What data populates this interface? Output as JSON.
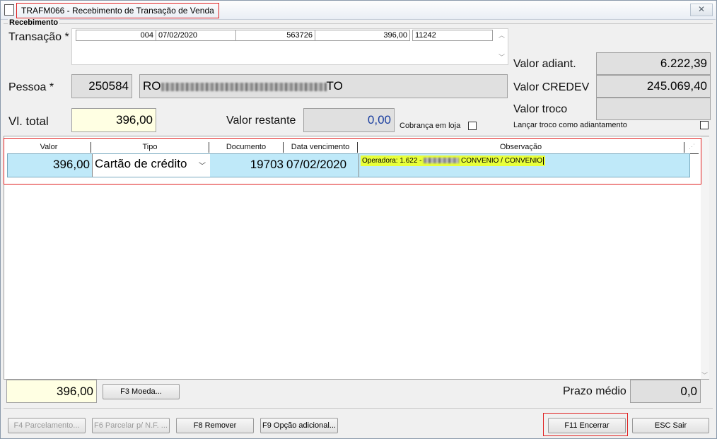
{
  "window": {
    "title": "TRAFM066 - Recebimento de Transação de Venda",
    "close_glyph": "✕"
  },
  "group": {
    "label": "Recebimento"
  },
  "transacao": {
    "label": "Transação *",
    "fields": [
      "004",
      "07/02/2020",
      "563726",
      "396,00",
      "11242"
    ]
  },
  "pessoa": {
    "label": "Pessoa *",
    "code": "250584",
    "name_start": "RO",
    "name_end": "TO"
  },
  "vl_total": {
    "label": "Vl. total",
    "value": "396,00"
  },
  "valor_restante": {
    "label": "Valor restante",
    "value": "0,00"
  },
  "cobranca_loja": {
    "label": "Cobrança em loja",
    "checked": false
  },
  "right_panel": {
    "adiant_label": "Valor adiant.",
    "adiant_value": "6.222,39",
    "credev_label": "Valor CREDEV",
    "credev_value": "245.069,40",
    "troco_label": "Valor troco",
    "troco_value": "",
    "lancar_label": "Lançar troco como adiantamento",
    "lancar_checked": false
  },
  "grid": {
    "headers": [
      "Valor",
      "Tipo",
      "Documento",
      "Data vencimento",
      "Observação"
    ],
    "rows": [
      {
        "valor": "396,00",
        "tipo": "Cartão de crédito",
        "documento": "19703",
        "data_vencimento": "07/02/2020",
        "obs_start": "Operadora: 1.622 - ",
        "obs_end": " CONVENIO / CONVENIO"
      }
    ]
  },
  "footer": {
    "total": "396,00",
    "moeda_button": "F3 Moeda...",
    "prazo_label": "Prazo médio",
    "prazo_value": "0,0"
  },
  "buttons": {
    "parcelamento": "F4 Parcelamento...",
    "parcelar_nf": "F6 Parcelar p/ N.F. ...",
    "remover": "F8 Remover",
    "opcao_adicional": "F9 Opção adicional...",
    "encerrar": "F11 Encerrar",
    "sair": "ESC Sair"
  },
  "colors": {
    "highlight_row": "#bfe9f9",
    "observation_highlight": "#e8ff3a",
    "annotation_red": "#e02020"
  },
  "icons": {
    "scroll_up": "chevron-up-icon",
    "scroll_down": "chevron-down-icon",
    "dropdown": "chevron-down-icon"
  }
}
